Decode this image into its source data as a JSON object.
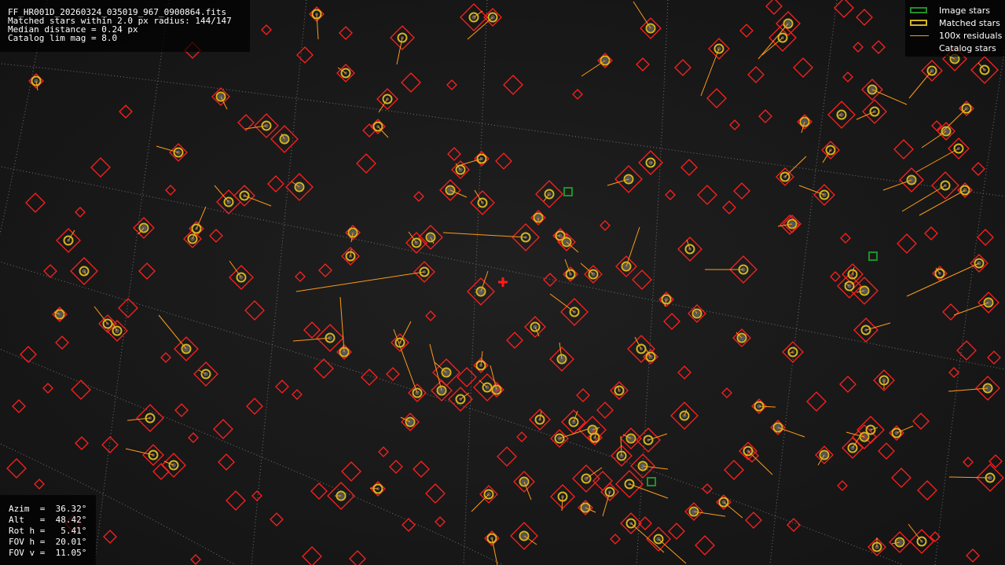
{
  "app": {
    "name": "fireball camera astrometry plate view"
  },
  "info": {
    "lines": [
      "FF_HR001D_20260324_035019_967_0900864.fits",
      "Matched stars within 2.0 px radius: 144/147",
      "Median distance = 0.24 px",
      "Catalog lim mag = 8.0"
    ]
  },
  "legend": {
    "items": [
      {
        "label": "Image stars",
        "color": "#1f8f2a",
        "kind": "box"
      },
      {
        "label": "Matched stars",
        "color": "#d4b41e",
        "kind": "box"
      },
      {
        "label": "100x residuals",
        "color": "#ff9a1a",
        "kind": "line"
      },
      {
        "label": "Catalog stars",
        "color": "#ff2020",
        "kind": "none"
      }
    ]
  },
  "pointing": {
    "lines": [
      "Azim  =  36.32°",
      "Alt   =  48.42°",
      "Rot h =   5.41°",
      "FOV h =  20.01°",
      "FOV v =  11.05°"
    ]
  },
  "colors": {
    "background": "#000000",
    "catalog": "#ff2020",
    "matched": "#d4b41e",
    "image_star": "#1f8f2a",
    "residual": "#ff9a1a",
    "grid": "#bbbbbb",
    "center_marker": "#ff1a1a"
  },
  "icons": {
    "center_marker": "red-cross-icon"
  },
  "plate": {
    "matched": [
      [
        403,
        18,
        405,
        50
      ],
      [
        627,
        22,
        595,
        50
      ],
      [
        828,
        36,
        806,
        2
      ],
      [
        512,
        48,
        505,
        82
      ],
      [
        603,
        22,
        614,
        14
      ],
      [
        770,
        77,
        740,
        97
      ],
      [
        440,
        93,
        430,
        86
      ],
      [
        915,
        62,
        892,
        122
      ],
      [
        1003,
        30,
        965,
        75
      ],
      [
        996,
        48,
        970,
        70
      ],
      [
        46,
        103,
        48,
        115
      ],
      [
        281,
        123,
        289,
        139
      ],
      [
        493,
        126,
        482,
        143
      ],
      [
        339,
        160,
        312,
        164
      ],
      [
        362,
        177,
        358,
        170
      ],
      [
        481,
        161,
        494,
        175
      ],
      [
        227,
        194,
        199,
        186
      ],
      [
        1110,
        114,
        1154,
        133
      ],
      [
        1113,
        142,
        1090,
        152
      ],
      [
        1071,
        146,
        1066,
        147
      ],
      [
        1024,
        155,
        1020,
        169
      ],
      [
        1057,
        191,
        1047,
        207
      ],
      [
        1186,
        90,
        1157,
        125
      ],
      [
        1215,
        75,
        1205,
        70
      ],
      [
        1253,
        89,
        1245,
        80
      ],
      [
        1230,
        138,
        1196,
        171
      ],
      [
        1204,
        167,
        1173,
        188
      ],
      [
        1220,
        189,
        1166,
        219
      ],
      [
        828,
        207,
        830,
        207
      ],
      [
        800,
        228,
        773,
        236
      ],
      [
        613,
        202,
        586,
        210
      ],
      [
        586,
        216,
        580,
        208
      ],
      [
        573,
        242,
        594,
        251
      ],
      [
        614,
        258,
        604,
        242
      ],
      [
        699,
        247,
        692,
        256
      ],
      [
        685,
        277,
        685,
        281
      ],
      [
        999,
        225,
        1026,
        199
      ],
      [
        1049,
        248,
        1017,
        236
      ],
      [
        1160,
        229,
        1124,
        242
      ],
      [
        1203,
        236,
        1148,
        269
      ],
      [
        1228,
        242,
        1170,
        274
      ],
      [
        1008,
        285,
        990,
        288
      ],
      [
        311,
        249,
        345,
        262
      ],
      [
        291,
        257,
        273,
        236
      ],
      [
        381,
        238,
        371,
        231
      ],
      [
        250,
        291,
        262,
        263
      ],
      [
        245,
        304,
        248,
        296
      ],
      [
        183,
        290,
        176,
        298
      ],
      [
        87,
        306,
        95,
        293
      ],
      [
        107,
        345,
        110,
        350
      ],
      [
        449,
        296,
        447,
        308
      ],
      [
        446,
        326,
        447,
        317
      ],
      [
        530,
        309,
        520,
        295
      ],
      [
        548,
        302,
        552,
        310
      ],
      [
        669,
        302,
        564,
        296
      ],
      [
        713,
        300,
        706,
        300
      ],
      [
        721,
        308,
        736,
        321
      ],
      [
        540,
        346,
        377,
        371
      ],
      [
        307,
        353,
        292,
        332
      ],
      [
        612,
        371,
        621,
        345
      ],
      [
        726,
        349,
        719,
        330
      ],
      [
        755,
        349,
        739,
        335
      ],
      [
        797,
        339,
        814,
        289
      ],
      [
        878,
        317,
        874,
        305
      ],
      [
        946,
        343,
        897,
        343
      ],
      [
        76,
        400,
        69,
        397
      ],
      [
        137,
        412,
        120,
        390
      ],
      [
        149,
        421,
        142,
        409
      ],
      [
        237,
        444,
        202,
        401
      ],
      [
        731,
        397,
        700,
        374
      ],
      [
        848,
        381,
        846,
        390
      ],
      [
        887,
        399,
        885,
        396
      ],
      [
        1085,
        349,
        1087,
        340
      ],
      [
        1081,
        364,
        1075,
        360
      ],
      [
        1100,
        370,
        1090,
        372
      ],
      [
        1196,
        348,
        1191,
        341
      ],
      [
        1246,
        335,
        1154,
        377
      ],
      [
        1258,
        385,
        1214,
        401
      ],
      [
        1102,
        420,
        1133,
        411
      ],
      [
        420,
        430,
        373,
        434
      ],
      [
        438,
        448,
        433,
        378
      ],
      [
        509,
        436,
        523,
        409
      ],
      [
        681,
        416,
        686,
        428
      ],
      [
        715,
        457,
        712,
        436
      ],
      [
        816,
        444,
        808,
        429
      ],
      [
        828,
        454,
        820,
        441
      ],
      [
        944,
        430,
        937,
        423
      ],
      [
        1009,
        448,
        1003,
        450
      ],
      [
        262,
        476,
        253,
        471
      ],
      [
        568,
        474,
        553,
        461
      ],
      [
        612,
        465,
        614,
        447
      ],
      [
        531,
        500,
        501,
        419
      ],
      [
        562,
        497,
        547,
        438
      ],
      [
        586,
        508,
        597,
        500
      ],
      [
        620,
        493,
        610,
        484
      ],
      [
        632,
        496,
        624,
        465
      ],
      [
        788,
        497,
        786,
        491
      ],
      [
        1125,
        484,
        1125,
        495
      ],
      [
        1257,
        494,
        1207,
        498
      ],
      [
        191,
        532,
        162,
        535
      ],
      [
        966,
        517,
        987,
        518
      ],
      [
        522,
        537,
        510,
        531
      ],
      [
        687,
        534,
        689,
        523
      ],
      [
        730,
        537,
        735,
        523
      ],
      [
        754,
        547,
        763,
        544
      ],
      [
        757,
        557,
        761,
        544
      ],
      [
        712,
        558,
        748,
        546
      ],
      [
        803,
        558,
        793,
        553
      ],
      [
        825,
        560,
        849,
        552
      ],
      [
        871,
        529,
        874,
        521
      ],
      [
        990,
        544,
        1024,
        556
      ],
      [
        952,
        574,
        983,
        604
      ],
      [
        1085,
        570,
        1094,
        556
      ],
      [
        1100,
        556,
        1077,
        550
      ],
      [
        1108,
        547,
        1117,
        544
      ],
      [
        1141,
        551,
        1162,
        542
      ],
      [
        1049,
        579,
        1041,
        592
      ],
      [
        195,
        579,
        160,
        571
      ],
      [
        221,
        592,
        209,
        587
      ],
      [
        434,
        631,
        426,
        631
      ],
      [
        481,
        622,
        471,
        621
      ],
      [
        622,
        629,
        600,
        651
      ],
      [
        667,
        613,
        676,
        636
      ],
      [
        716,
        632,
        715,
        650
      ],
      [
        746,
        609,
        766,
        595
      ],
      [
        745,
        646,
        758,
        652
      ],
      [
        776,
        626,
        767,
        657
      ],
      [
        791,
        580,
        790,
        555
      ],
      [
        818,
        593,
        850,
        597
      ],
      [
        801,
        616,
        850,
        634
      ],
      [
        921,
        639,
        945,
        659
      ],
      [
        883,
        651,
        923,
        657
      ],
      [
        803,
        666,
        845,
        703
      ],
      [
        838,
        686,
        873,
        717
      ],
      [
        667,
        682,
        683,
        693
      ],
      [
        626,
        685,
        633,
        719
      ],
      [
        1116,
        696,
        1116,
        684
      ],
      [
        1145,
        690,
        1135,
        692
      ],
      [
        1173,
        689,
        1156,
        667
      ],
      [
        1260,
        608,
        1208,
        607
      ]
    ],
    "image_only": [
      [
        723,
        244
      ],
      [
        1111,
        326
      ],
      [
        829,
        613
      ]
    ],
    "catalog_extra": [
      [
        339,
        38
      ],
      [
        440,
        42
      ],
      [
        388,
        70
      ],
      [
        523,
        105
      ],
      [
        575,
        108
      ],
      [
        470,
        166
      ],
      [
        313,
        156
      ],
      [
        128,
        213
      ],
      [
        217,
        242
      ],
      [
        275,
        300
      ],
      [
        351,
        234
      ],
      [
        45,
        258
      ],
      [
        102,
        270
      ],
      [
        64,
        345
      ],
      [
        187,
        345
      ],
      [
        324,
        395
      ],
      [
        382,
        352
      ],
      [
        414,
        344
      ],
      [
        397,
        420
      ],
      [
        466,
        208
      ],
      [
        533,
        250
      ],
      [
        578,
        196
      ],
      [
        641,
        205
      ],
      [
        653,
        108
      ],
      [
        735,
        120
      ],
      [
        818,
        82
      ],
      [
        869,
        86
      ],
      [
        912,
        125
      ],
      [
        935,
        159
      ],
      [
        974,
        148
      ],
      [
        962,
        95
      ],
      [
        1022,
        86
      ],
      [
        1079,
        98
      ],
      [
        1118,
        60
      ],
      [
        1100,
        22
      ],
      [
        1150,
        190
      ],
      [
        1192,
        160
      ],
      [
        1245,
        215
      ],
      [
        1254,
        302
      ],
      [
        1154,
        310
      ],
      [
        1063,
        352
      ],
      [
        1185,
        297
      ],
      [
        1210,
        397
      ],
      [
        1230,
        446
      ],
      [
        1214,
        474
      ],
      [
        1265,
        455
      ],
      [
        1172,
        536
      ],
      [
        1147,
        608
      ],
      [
        1190,
        683
      ],
      [
        1238,
        707
      ],
      [
        1079,
        489
      ],
      [
        1039,
        511
      ],
      [
        1072,
        618
      ],
      [
        1010,
        668
      ],
      [
        959,
        662
      ],
      [
        934,
        598
      ],
      [
        925,
        500
      ],
      [
        871,
        474
      ],
      [
        855,
        409
      ],
      [
        817,
        356
      ],
      [
        770,
        287
      ],
      [
        700,
        356
      ],
      [
        655,
        433
      ],
      [
        594,
        480
      ],
      [
        548,
        402
      ],
      [
        500,
        476
      ],
      [
        470,
        480
      ],
      [
        412,
        469
      ],
      [
        378,
        502
      ],
      [
        359,
        492
      ],
      [
        324,
        517
      ],
      [
        284,
        546
      ],
      [
        246,
        557
      ],
      [
        231,
        522
      ],
      [
        140,
        566
      ],
      [
        103,
        496
      ],
      [
        61,
        494
      ],
      [
        24,
        517
      ],
      [
        36,
        451
      ],
      [
        21,
        596
      ],
      [
        50,
        616
      ],
      [
        104,
        564
      ],
      [
        288,
        588
      ],
      [
        300,
        637
      ],
      [
        327,
        631
      ],
      [
        352,
        661
      ],
      [
        406,
        625
      ],
      [
        447,
        600
      ],
      [
        488,
        575
      ],
      [
        504,
        594
      ],
      [
        536,
        597
      ],
      [
        554,
        628
      ],
      [
        560,
        664
      ],
      [
        520,
        668
      ],
      [
        455,
        711
      ],
      [
        397,
        708
      ],
      [
        249,
        712
      ],
      [
        140,
        683
      ],
      [
        93,
        666
      ],
      [
        645,
        581
      ],
      [
        664,
        556
      ],
      [
        742,
        503
      ],
      [
        770,
        522
      ],
      [
        767,
        612
      ],
      [
        783,
        686
      ],
      [
        821,
        666
      ],
      [
        861,
        676
      ],
      [
        897,
        694
      ],
      [
        900,
        622
      ],
      [
        957,
        580
      ],
      [
        1128,
        574
      ],
      [
        1180,
        624
      ],
      [
        1232,
        588
      ],
      [
        1267,
        587
      ],
      [
        877,
        213
      ],
      [
        900,
        248
      ],
      [
        853,
        248
      ],
      [
        928,
        264
      ],
      [
        944,
        243
      ],
      [
        1005,
        286
      ],
      [
        1076,
        303
      ],
      [
        950,
        39
      ],
      [
        985,
        8
      ],
      [
        1074,
        10
      ],
      [
        1092,
        60
      ],
      [
        160,
        142
      ],
      [
        245,
        64
      ],
      [
        163,
        392
      ],
      [
        211,
        455
      ],
      [
        79,
        436
      ],
      [
        205,
        600
      ]
    ]
  }
}
